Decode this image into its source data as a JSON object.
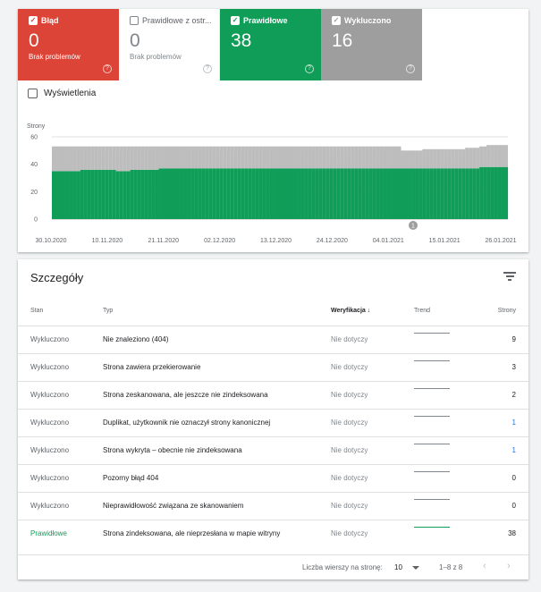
{
  "tiles": [
    {
      "label": "Błąd",
      "value": "0",
      "sub": "Brak problemów",
      "checked": true,
      "color": "#db4437"
    },
    {
      "label": "Prawidłowe z ostr...",
      "value": "0",
      "sub": "Brak problemów",
      "checked": false,
      "color": "#ffffff"
    },
    {
      "label": "Prawidłowe",
      "value": "38",
      "sub": "",
      "checked": true,
      "color": "#0f9d58"
    },
    {
      "label": "Wykluczono",
      "value": "16",
      "sub": "",
      "checked": true,
      "color": "#9e9e9e"
    }
  ],
  "help_glyph": "?",
  "check_glyph": "✓",
  "impressions_label": "Wyświetlenia",
  "chart_data": {
    "type": "bar",
    "stacked": true,
    "ylabel": "Strony",
    "ylim": [
      0,
      60
    ],
    "yticks": [
      "0",
      "20",
      "40",
      "60"
    ],
    "xticks": [
      "30.10.2020",
      "10.11.2020",
      "21.11.2020",
      "02.12.2020",
      "13.12.2020",
      "24.12.2020",
      "04.01.2021",
      "15.01.2021",
      "26.01.2021"
    ],
    "annotation": "1",
    "series": [
      {
        "name": "Prawidłowe",
        "color": "#0f9d58",
        "values": [
          35,
          35,
          35,
          35,
          35,
          35,
          35,
          35,
          36,
          36,
          36,
          36,
          36,
          36,
          36,
          36,
          36,
          36,
          35,
          35,
          35,
          35,
          36,
          36,
          36,
          36,
          36,
          36,
          36,
          36,
          37,
          37,
          37,
          37,
          37,
          37,
          37,
          37,
          37,
          37,
          37,
          37,
          37,
          37,
          37,
          37,
          37,
          37,
          37,
          37,
          37,
          37,
          37,
          37,
          37,
          37,
          37,
          37,
          37,
          37,
          37,
          37,
          37,
          37,
          37,
          37,
          37,
          37,
          37,
          37,
          37,
          37,
          37,
          37,
          37,
          37,
          37,
          37,
          37,
          37,
          37,
          37,
          37,
          37,
          37,
          37,
          37,
          37,
          37,
          37,
          37,
          37,
          37,
          37,
          37,
          37,
          37,
          37,
          37,
          37,
          37,
          37,
          37,
          37,
          37,
          37,
          37,
          37,
          37,
          37,
          37,
          37,
          37,
          37,
          37,
          37,
          37,
          37,
          37,
          37,
          38,
          38,
          38,
          38,
          38,
          38,
          38,
          38
        ]
      },
      {
        "name": "Wykluczono",
        "color": "#bdbdbd",
        "values": [
          18,
          18,
          18,
          18,
          18,
          18,
          18,
          18,
          17,
          17,
          17,
          17,
          17,
          17,
          17,
          17,
          17,
          17,
          18,
          18,
          18,
          18,
          17,
          17,
          17,
          17,
          17,
          17,
          17,
          17,
          16,
          16,
          16,
          16,
          16,
          16,
          16,
          16,
          16,
          16,
          16,
          16,
          16,
          16,
          16,
          16,
          16,
          16,
          16,
          16,
          16,
          16,
          16,
          16,
          16,
          16,
          16,
          16,
          16,
          16,
          16,
          16,
          16,
          16,
          16,
          16,
          16,
          16,
          16,
          16,
          16,
          16,
          16,
          16,
          16,
          16,
          16,
          16,
          16,
          16,
          16,
          16,
          16,
          16,
          16,
          16,
          16,
          16,
          16,
          16,
          16,
          16,
          16,
          16,
          16,
          16,
          16,
          16,
          13,
          13,
          13,
          13,
          13,
          13,
          14,
          14,
          14,
          14,
          14,
          14,
          14,
          14,
          14,
          14,
          14,
          14,
          15,
          15,
          15,
          15,
          15,
          15,
          16,
          16,
          16,
          16,
          16,
          16
        ]
      }
    ]
  },
  "details": {
    "title": "Szczegóły",
    "headers": {
      "stan": "Stan",
      "typ": "Typ",
      "weryfikacja": "Weryfikacja",
      "sort_glyph": "↓",
      "trend": "Trend",
      "strony": "Strony"
    },
    "rows": [
      {
        "stan": "Wykluczono",
        "typ": "Nie znaleziono (404)",
        "weryfikacja": "Nie dotyczy",
        "strony": "9"
      },
      {
        "stan": "Wykluczono",
        "typ": "Strona zawiera przekierowanie",
        "weryfikacja": "Nie dotyczy",
        "strony": "3"
      },
      {
        "stan": "Wykluczono",
        "typ": "Strona zeskanowana, ale jeszcze nie zindeksowana",
        "weryfikacja": "Nie dotyczy",
        "strony": "2"
      },
      {
        "stan": "Wykluczono",
        "typ": "Duplikat, użytkownik nie oznaczył strony kanonicznej",
        "weryfikacja": "Nie dotyczy",
        "strony": "1"
      },
      {
        "stan": "Wykluczono",
        "typ": "Strona wykryta – obecnie nie zindeksowana",
        "weryfikacja": "Nie dotyczy",
        "strony": "1"
      },
      {
        "stan": "Wykluczono",
        "typ": "Pozorny błąd 404",
        "weryfikacja": "Nie dotyczy",
        "strony": "0"
      },
      {
        "stan": "Wykluczono",
        "typ": "Nieprawidłowość związana ze skanowaniem",
        "weryfikacja": "Nie dotyczy",
        "strony": "0"
      },
      {
        "stan": "Prawidłowe",
        "typ": "Strona zindeksowana, ale nieprzesłana w mapie witryny",
        "weryfikacja": "Nie dotyczy",
        "strony": "38"
      }
    ],
    "pagination": {
      "rows_per_page_label": "Liczba wierszy na stronę:",
      "rows_per_page": "10",
      "range": "1–8 z 8",
      "prev": "‹",
      "next": "›"
    }
  }
}
